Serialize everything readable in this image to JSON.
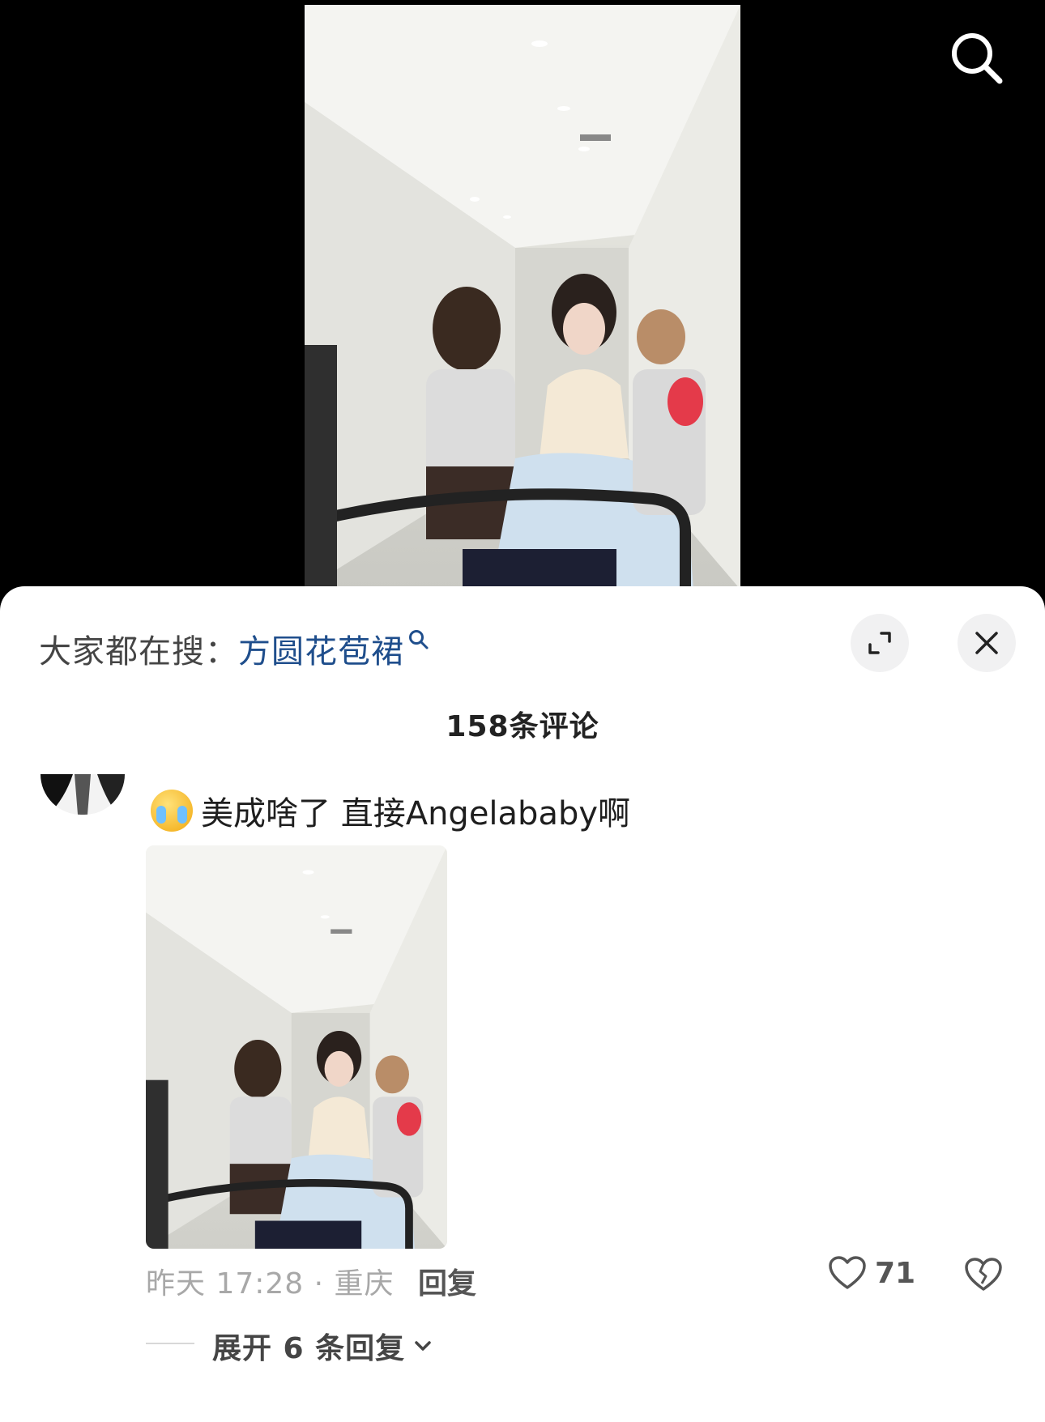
{
  "header": {
    "search_icon": "search-icon"
  },
  "video": {
    "description_icon": "video-frame"
  },
  "sheet": {
    "trending_prefix": "大家都在搜：",
    "trending_keyword": "方圆花苞裙",
    "expand_icon": "expand-icon",
    "close_icon": "close-icon",
    "comment_count_title": "158条评论"
  },
  "comment": {
    "text": "美成啥了 直接Angelababy啊",
    "emoji": "crying-face-emoji",
    "time_location": "昨天 17:28 · 重庆",
    "reply_label": "回复",
    "like_count": "71",
    "expand_replies_label": "展开 6 条回复"
  },
  "colors": {
    "keyword": "#1f4e8c",
    "sheet_bg": "#ffffff",
    "page_bg": "#000000",
    "meta_gray": "#a8a8a8"
  }
}
